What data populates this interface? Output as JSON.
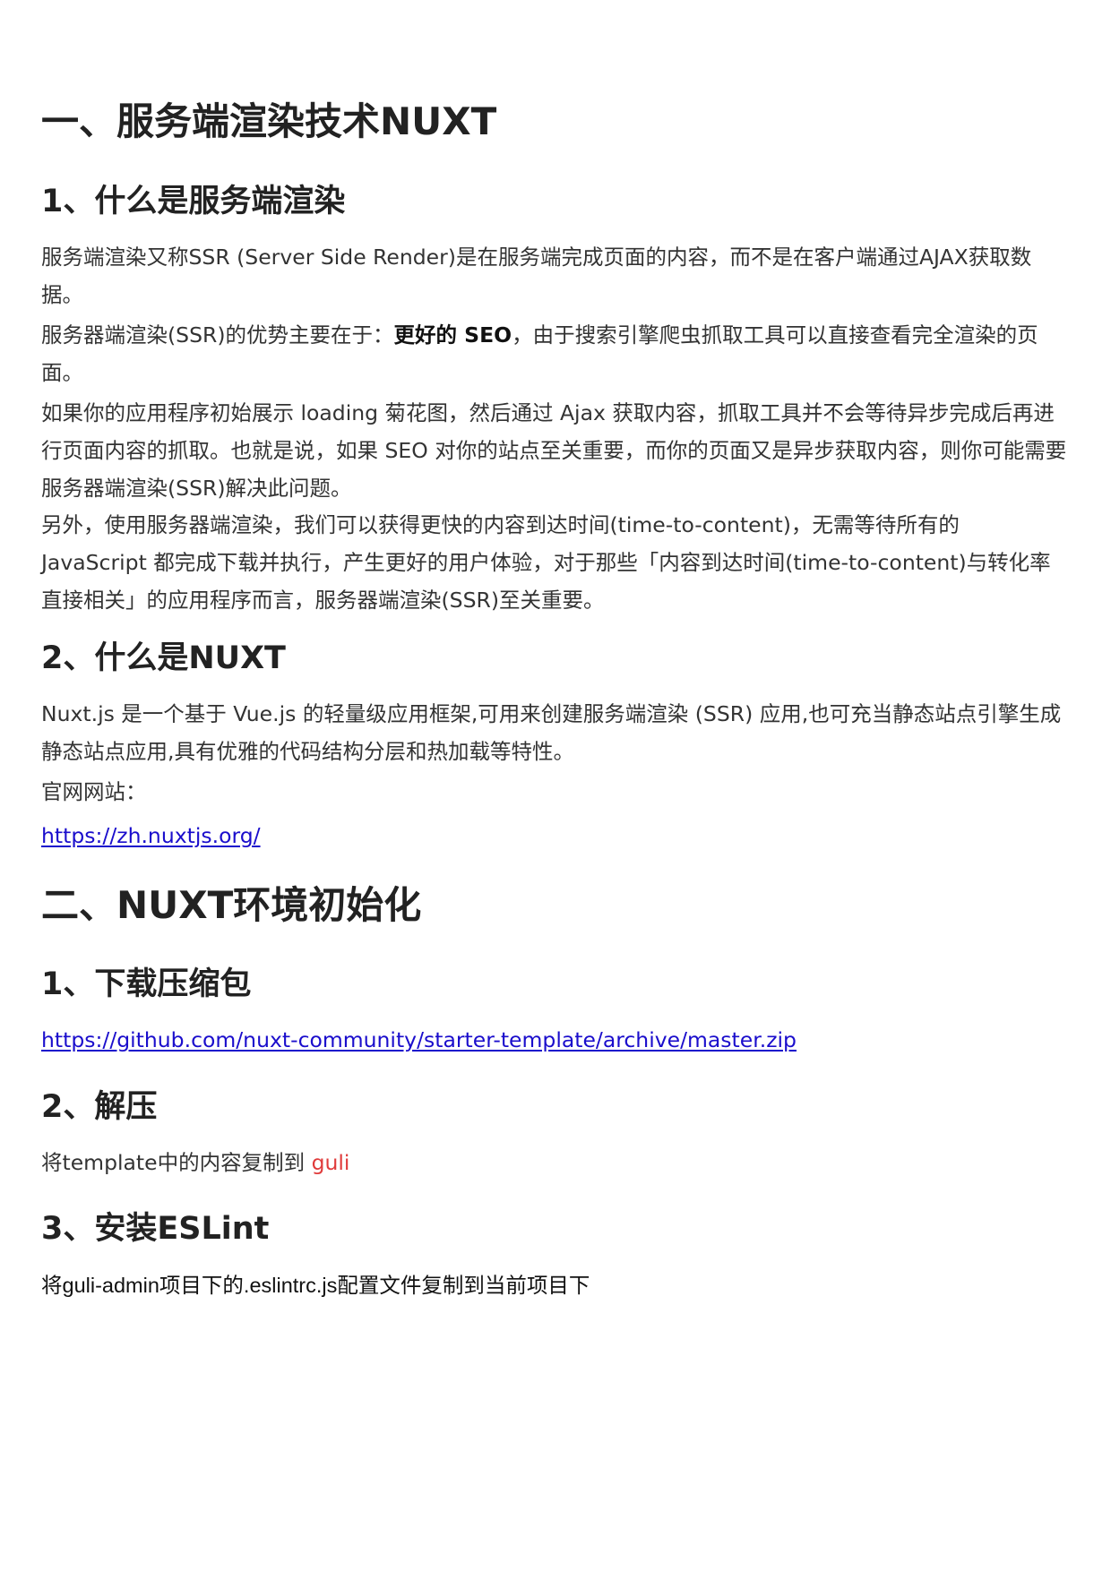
{
  "sections": {
    "s1": {
      "title": "一、服务端渲染技术NUXT",
      "sub1": {
        "title": "1、什么是服务端渲染",
        "p1": "服务端渲染又称SSR (Server Side Render)是在服务端完成页面的内容，而不是在客户端通过AJAX获取数据。",
        "p2_pre": "服务器端渲染(SSR)的优势主要在于：",
        "p2_strong": "更好的 SEO",
        "p2_post": "，由于搜索引擎爬虫抓取工具可以直接查看完全渲染的页面。",
        "p3": "如果你的应用程序初始展示 loading 菊花图，然后通过 Ajax 获取内容，抓取工具并不会等待异步完成后再进行页面内容的抓取。也就是说，如果 SEO 对你的站点至关重要，而你的页面又是异步获取内容，则你可能需要服务器端渲染(SSR)解决此问题。",
        "p4": "另外，使用服务器端渲染，我们可以获得更快的内容到达时间(time-to-content)，无需等待所有的 JavaScript 都完成下载并执行，产生更好的用户体验，对于那些「内容到达时间(time-to-content)与转化率直接相关」的应用程序而言，服务器端渲染(SSR)至关重要。"
      },
      "sub2": {
        "title": "2、什么是NUXT",
        "p1": "Nuxt.js 是一个基于 Vue.js 的轻量级应用框架,可用来创建服务端渲染 (SSR) 应用,也可充当静态站点引擎生成静态站点应用,具有优雅的代码结构分层和热加载等特性。",
        "site_label": "官网网站：",
        "site_link": "https://zh.nuxtjs.org/"
      }
    },
    "s2": {
      "title": "二、NUXT环境初始化",
      "sub1": {
        "title": "1、下载压缩包",
        "link": "https://github.com/nuxt-community/starter-template/archive/master.zip"
      },
      "sub2": {
        "title": "2、解压",
        "text_pre": "将template中的内容复制到 ",
        "text_red": "guli"
      },
      "sub3": {
        "title": "3、安装ESLint",
        "text": "将guli-admin项目下的.eslintrc.js配置文件复制到当前项目下"
      }
    }
  },
  "colors": {
    "link": "#1a0dcc",
    "highlight_red": "#e03b3b",
    "heading": "#222222",
    "body": "#333333"
  }
}
